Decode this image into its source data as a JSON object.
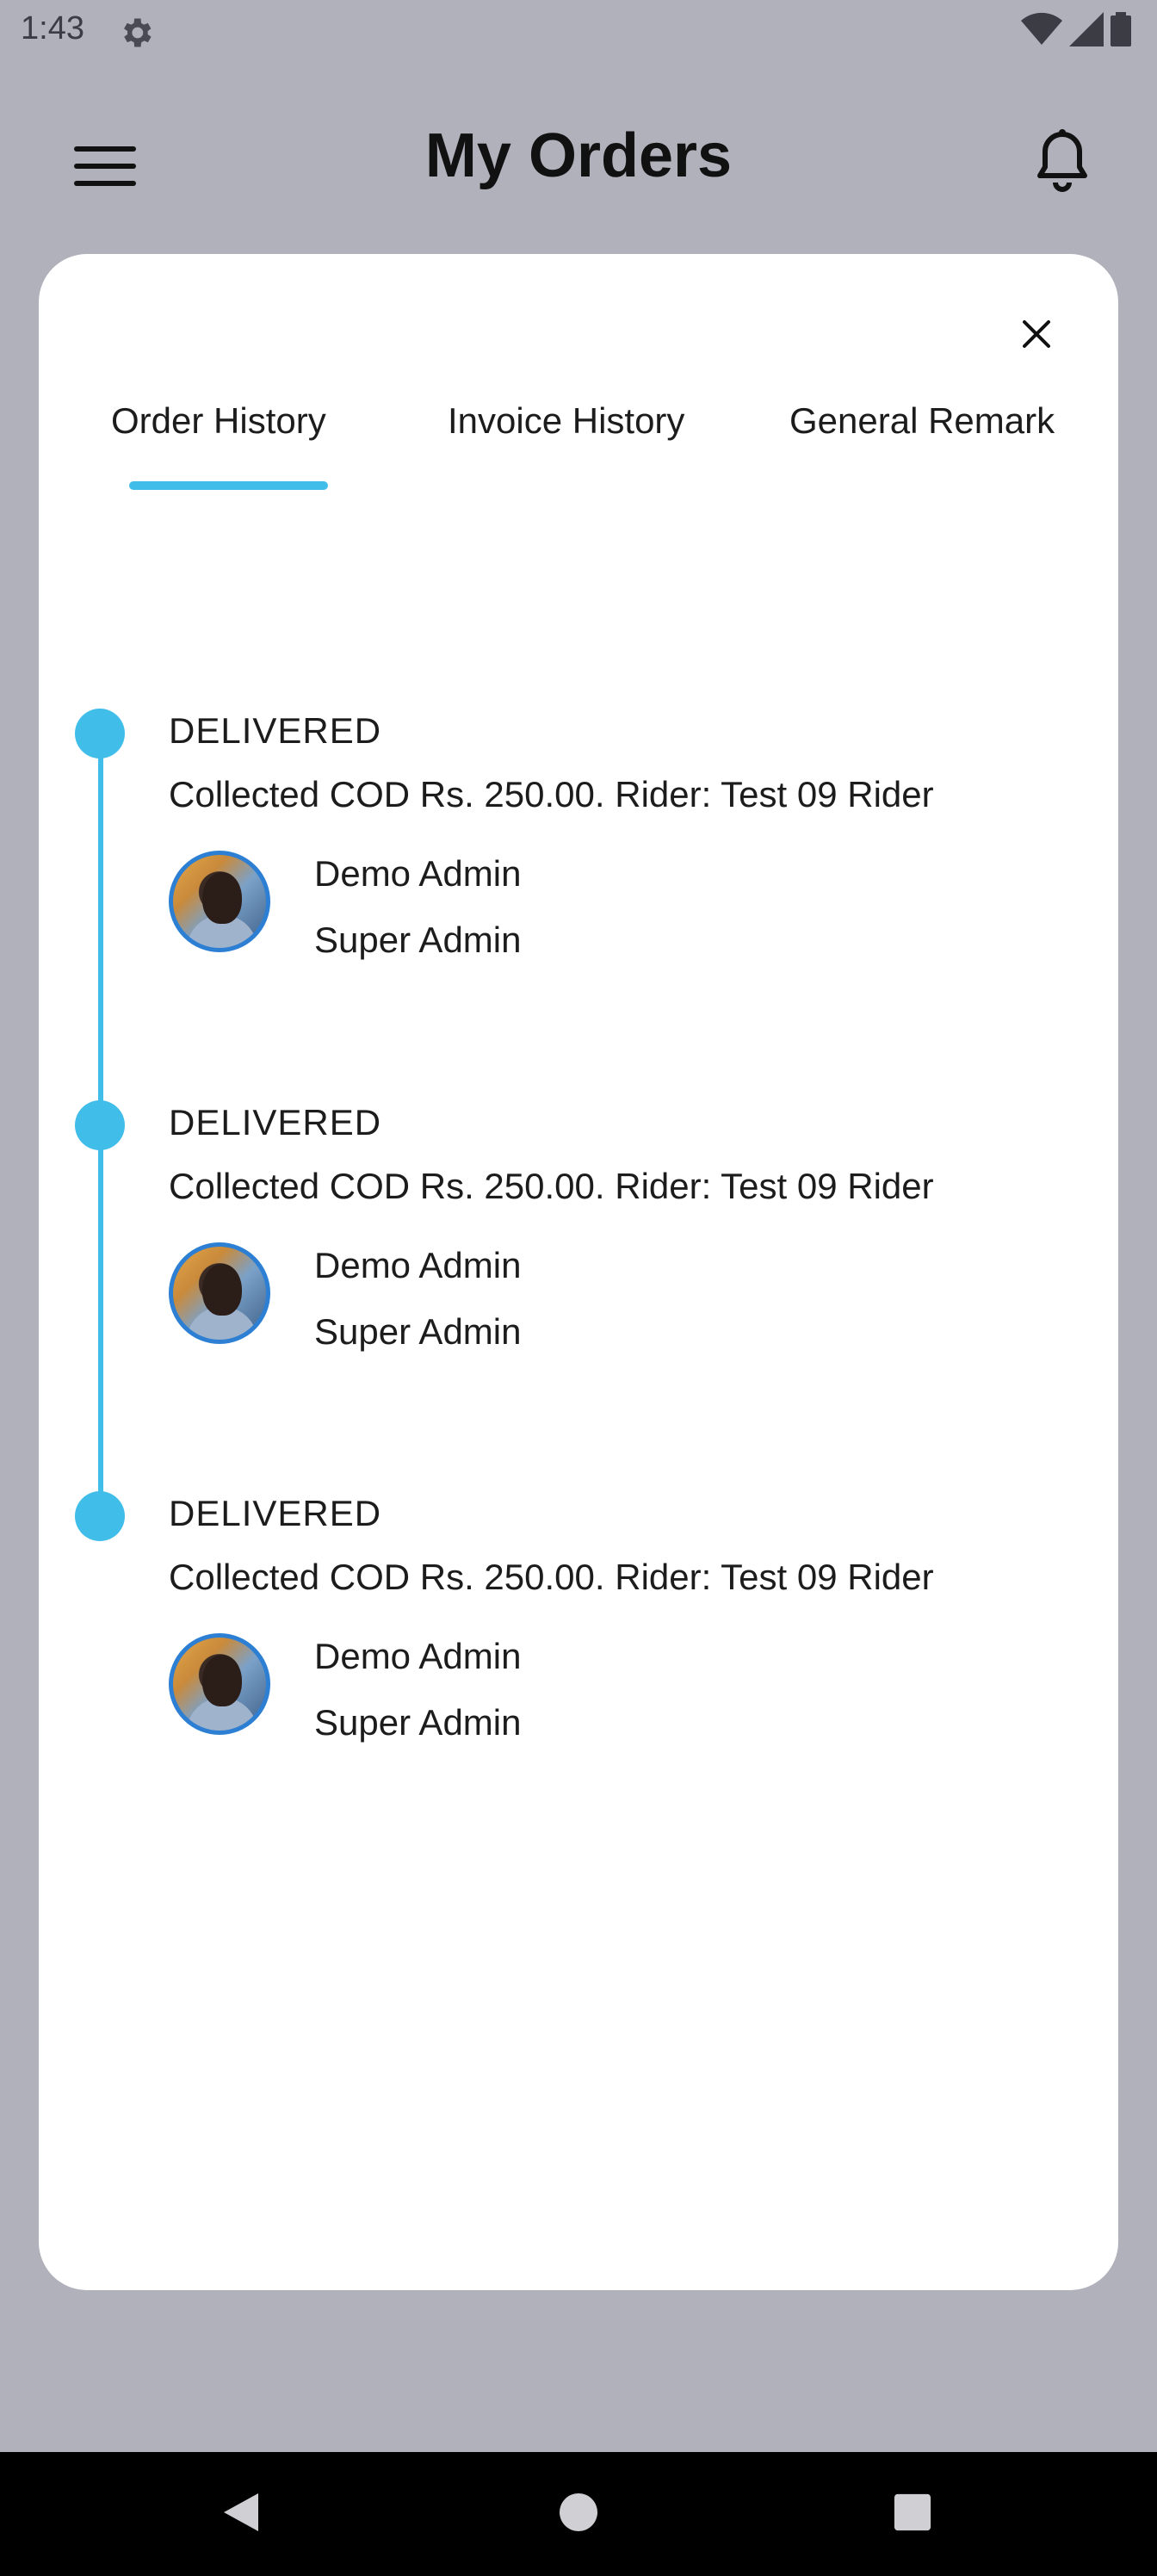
{
  "status_bar": {
    "time": "1:43"
  },
  "app_bar": {
    "title": "My Orders"
  },
  "tabs": [
    {
      "label": "Order History",
      "active": true
    },
    {
      "label": "Invoice History",
      "active": false
    },
    {
      "label": "General Remark",
      "active": false
    }
  ],
  "timeline": [
    {
      "status": "DELIVERED",
      "detail": "Collected COD Rs. 250.00. Rider: Test 09 Rider",
      "name": "Demo Admin",
      "role": "Super Admin"
    },
    {
      "status": "DELIVERED",
      "detail": "Collected COD Rs. 250.00. Rider: Test 09 Rider",
      "name": "Demo Admin",
      "role": "Super Admin"
    },
    {
      "status": "DELIVERED",
      "detail": "Collected COD Rs. 250.00. Rider: Test 09 Rider",
      "name": "Demo Admin",
      "role": "Super Admin"
    }
  ],
  "colors": {
    "accent": "#41bde9",
    "overlay": "#b0b1bb",
    "card": "#ffffff"
  },
  "icons": [
    "settings-icon",
    "wifi-icon",
    "signal-icon",
    "battery-icon",
    "menu-icon",
    "bell-icon",
    "close-icon",
    "back-icon",
    "home-icon",
    "recents-icon"
  ]
}
